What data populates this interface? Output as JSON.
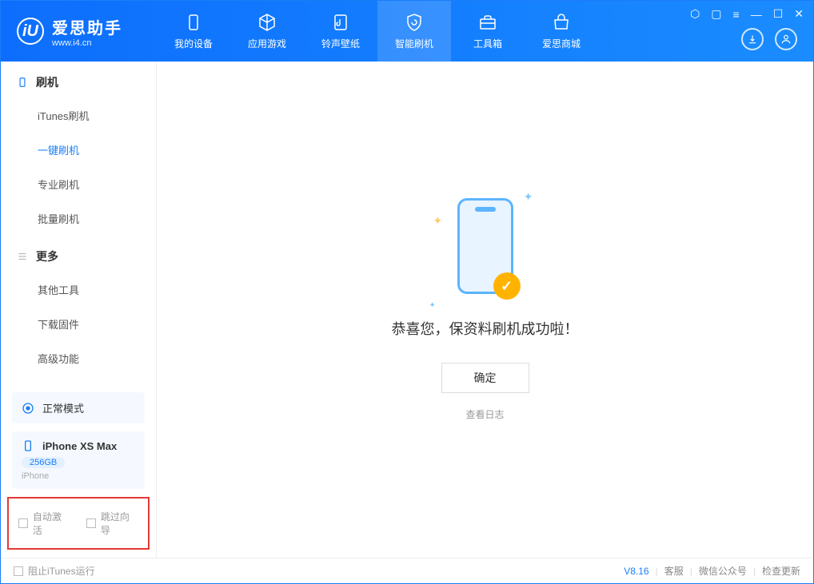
{
  "app": {
    "title": "爱思助手",
    "subtitle": "www.i4.cn"
  },
  "tabs": [
    {
      "label": "我的设备"
    },
    {
      "label": "应用游戏"
    },
    {
      "label": "铃声壁纸"
    },
    {
      "label": "智能刷机"
    },
    {
      "label": "工具箱"
    },
    {
      "label": "爱思商城"
    }
  ],
  "sidebar": {
    "section1_title": "刷机",
    "items1": [
      {
        "label": "iTunes刷机"
      },
      {
        "label": "一键刷机"
      },
      {
        "label": "专业刷机"
      },
      {
        "label": "批量刷机"
      }
    ],
    "section2_title": "更多",
    "items2": [
      {
        "label": "其他工具"
      },
      {
        "label": "下载固件"
      },
      {
        "label": "高级功能"
      }
    ]
  },
  "device": {
    "mode": "正常模式",
    "name": "iPhone XS Max",
    "storage": "256GB",
    "type": "iPhone"
  },
  "checkboxes": {
    "auto_activate": "自动激活",
    "skip_guide": "跳过向导"
  },
  "main": {
    "success_msg": "恭喜您，保资料刷机成功啦！",
    "ok": "确定",
    "view_log": "查看日志"
  },
  "footer": {
    "block_itunes": "阻止iTunes运行",
    "version": "V8.16",
    "links": [
      "客服",
      "微信公众号",
      "检查更新"
    ]
  }
}
